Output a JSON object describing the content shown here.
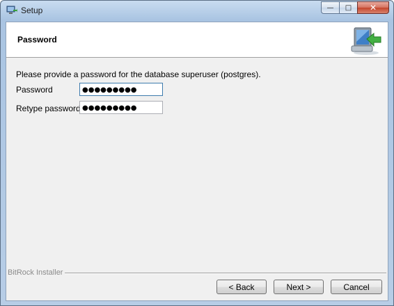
{
  "window": {
    "title": "Setup",
    "buttons": {
      "minimize": "—",
      "maximize": "□",
      "close": "✕"
    }
  },
  "header": {
    "title": "Password",
    "icon": "installer-computer-arrow-icon"
  },
  "form": {
    "description": "Please provide a password for the database superuser (postgres).",
    "password_label": "Password",
    "password_value": "●●●●●●●●●",
    "retype_label": "Retype password",
    "retype_value": "●●●●●●●●●"
  },
  "footer": {
    "brand": "BitRock Installer",
    "back_label": "< Back",
    "next_label": "Next >",
    "cancel_label": "Cancel"
  }
}
